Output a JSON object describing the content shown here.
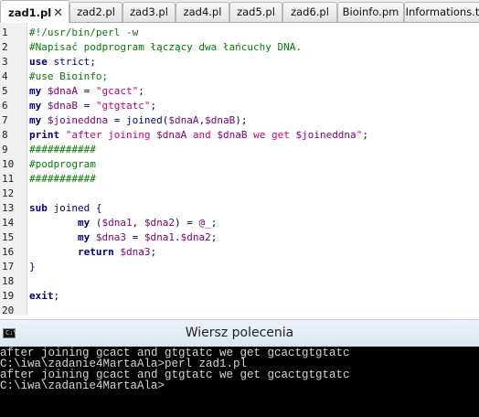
{
  "tabs": [
    {
      "label": "zad1.pl",
      "active": true,
      "close": "✕"
    },
    {
      "label": "zad2.pl"
    },
    {
      "label": "zad3.pl"
    },
    {
      "label": "zad4.pl"
    },
    {
      "label": "zad5.pl"
    },
    {
      "label": "zad6.pl"
    },
    {
      "label": "Bioinfo.pm"
    },
    {
      "label": "Informations.t"
    }
  ],
  "editor": {
    "lines": [
      {
        "n": "1",
        "tokens": [
          [
            "c-comment",
            "#!/usr/bin/perl -w"
          ]
        ]
      },
      {
        "n": "2",
        "tokens": [
          [
            "c-comment",
            "#Napisać podprogram łączący dwa łańcuchy DNA."
          ]
        ]
      },
      {
        "n": "3",
        "tokens": [
          [
            "c-kw",
            "use"
          ],
          [
            "c-plain",
            " strict;"
          ]
        ]
      },
      {
        "n": "4",
        "tokens": [
          [
            "c-comment",
            "#use Bioinfo;"
          ]
        ]
      },
      {
        "n": "5",
        "tokens": [
          [
            "c-kw",
            "my"
          ],
          [
            "c-var",
            " $dnaA"
          ],
          [
            "c-plain",
            " = "
          ],
          [
            "c-str",
            "\"gcact\""
          ],
          [
            "c-plain",
            ";"
          ]
        ]
      },
      {
        "n": "6",
        "tokens": [
          [
            "c-kw",
            "my"
          ],
          [
            "c-var",
            " $dnaB"
          ],
          [
            "c-plain",
            " = "
          ],
          [
            "c-str",
            "\"gtgtatc\""
          ],
          [
            "c-plain",
            ";"
          ]
        ]
      },
      {
        "n": "7",
        "tokens": [
          [
            "c-kw",
            "my"
          ],
          [
            "c-var",
            " $joineddna"
          ],
          [
            "c-plain",
            " = joined("
          ],
          [
            "c-var",
            "$dnaA"
          ],
          [
            "c-plain",
            ","
          ],
          [
            "c-var",
            "$dnaB"
          ],
          [
            "c-plain",
            ");"
          ]
        ]
      },
      {
        "n": "8",
        "tokens": [
          [
            "c-kw",
            "print"
          ],
          [
            "c-str",
            " \"after joining "
          ],
          [
            "c-var",
            "$dnaA"
          ],
          [
            "c-str",
            " and "
          ],
          [
            "c-var",
            "$dnaB"
          ],
          [
            "c-str",
            " we get "
          ],
          [
            "c-var",
            "$joineddna"
          ],
          [
            "c-str",
            "\""
          ],
          [
            "c-plain",
            ";"
          ]
        ]
      },
      {
        "n": "9",
        "tokens": [
          [
            "c-hash",
            "###########"
          ]
        ]
      },
      {
        "n": "10",
        "tokens": [
          [
            "c-comment",
            "#podprogram"
          ]
        ]
      },
      {
        "n": "11",
        "tokens": [
          [
            "c-hash",
            "###########"
          ]
        ]
      },
      {
        "n": "12",
        "tokens": []
      },
      {
        "n": "13",
        "tokens": [
          [
            "c-kw",
            "sub"
          ],
          [
            "c-plain",
            " joined {"
          ]
        ]
      },
      {
        "n": "14",
        "tokens": [
          [
            "c-plain",
            "        "
          ],
          [
            "c-kw",
            "my"
          ],
          [
            "c-plain",
            " ("
          ],
          [
            "c-var",
            "$dna1"
          ],
          [
            "c-plain",
            ", "
          ],
          [
            "c-var",
            "$dna2"
          ],
          [
            "c-plain",
            ") = "
          ],
          [
            "c-var",
            "@_"
          ],
          [
            "c-plain",
            ";"
          ]
        ]
      },
      {
        "n": "15",
        "tokens": [
          [
            "c-plain",
            "        "
          ],
          [
            "c-kw",
            "my"
          ],
          [
            "c-var",
            " $dna3"
          ],
          [
            "c-plain",
            " = "
          ],
          [
            "c-var",
            "$dna1"
          ],
          [
            "c-plain",
            "."
          ],
          [
            "c-var",
            "$dna2"
          ],
          [
            "c-plain",
            ";"
          ]
        ]
      },
      {
        "n": "16",
        "tokens": [
          [
            "c-plain",
            "        "
          ],
          [
            "c-kw",
            "return"
          ],
          [
            "c-var",
            " $dna3"
          ],
          [
            "c-plain",
            ";"
          ]
        ]
      },
      {
        "n": "17",
        "tokens": [
          [
            "c-plain",
            "}"
          ]
        ]
      },
      {
        "n": "18",
        "tokens": []
      },
      {
        "n": "19",
        "tokens": [
          [
            "c-kw",
            "exit"
          ],
          [
            "c-plain",
            ";"
          ]
        ]
      },
      {
        "n": "20",
        "tokens": []
      }
    ]
  },
  "command_window": {
    "title": "Wiersz polecenia",
    "icon_text": "C:\\",
    "lines": [
      "after joining gcact and gtgtatc we get gcactgtgtatc",
      "C:\\iwa\\zadanie4MartaAla>perl zad1.pl",
      "after joining gcact and gtgtatc we get gcactgtgtatc",
      "C:\\iwa\\zadanie4MartaAla>"
    ]
  }
}
